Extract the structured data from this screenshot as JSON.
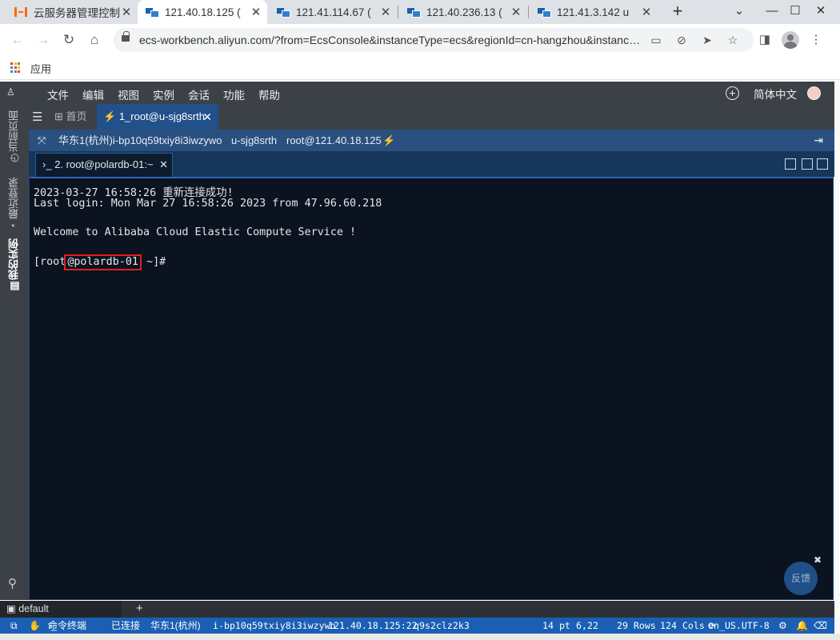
{
  "browser": {
    "tabs": [
      {
        "title": "云服务器管理控制",
        "icon": "aliyun-icon"
      },
      {
        "title": "121.40.18.125 (",
        "icon": "remote-terminal-icon"
      },
      {
        "title": "121.41.114.67 (",
        "icon": "remote-terminal-icon"
      },
      {
        "title": "121.40.236.13 (",
        "icon": "remote-terminal-icon"
      },
      {
        "title": "121.41.3.142 u",
        "icon": "remote-terminal-icon"
      }
    ],
    "close_glyph": "✕",
    "url": "ecs-workbench.aliyun.com/?from=EcsConsole&instanceType=ecs&regionId=cn-hangzhou&instanc…",
    "bookmarks_label": "应用"
  },
  "workbench": {
    "menu": [
      "文件",
      "编辑",
      "视图",
      "实例",
      "会话",
      "功能",
      "帮助"
    ],
    "language": "简体中文",
    "rail": [
      "当前页面",
      "最近登录",
      "我的实例"
    ],
    "home_tab": "首页",
    "session_tab": "1_root@u-sjg8srth",
    "info": {
      "instance": "华东1(杭州)i-bp10q59txiy8i3iwzywo",
      "hostname": "u-sjg8srth",
      "login": "root@121.40.18.125"
    },
    "terminal_tab": "2. root@polardb-01:~",
    "terminal": {
      "line1": "2023-03-27 16:58:26 重新连接成功!",
      "line2": "Last login: Mon Mar 27 16:58:26 2023 from 47.96.60.218",
      "line3": "Welcome to Alibaba Cloud Elastic Compute Service !",
      "prompt_prefix": "[root",
      "prompt_host": "@polardb-01",
      "prompt_suffix": " ~]#"
    },
    "feedback": "反馈",
    "session_group": "default",
    "status": {
      "mode": "命令终端",
      "state": "已连接",
      "region": "华东1(杭州)",
      "instance": "i-bp10q59txiy8i3iwzywo",
      "address": "121.40.18.125:22",
      "session": "q9s2clz2k3",
      "font_size": "14 pt",
      "cursor": "6,22",
      "rows": "29 Rows",
      "cols": "124 Cols",
      "encoding": "en_US.UTF-8"
    }
  },
  "colors": {
    "menubar": "#3c4147",
    "info_bar": "#29507f",
    "terminal_bg": "#0b1320",
    "status_bar": "#1a5fb4",
    "highlight_box": "#e02020",
    "aliyun_orange": "#ff6a00"
  }
}
